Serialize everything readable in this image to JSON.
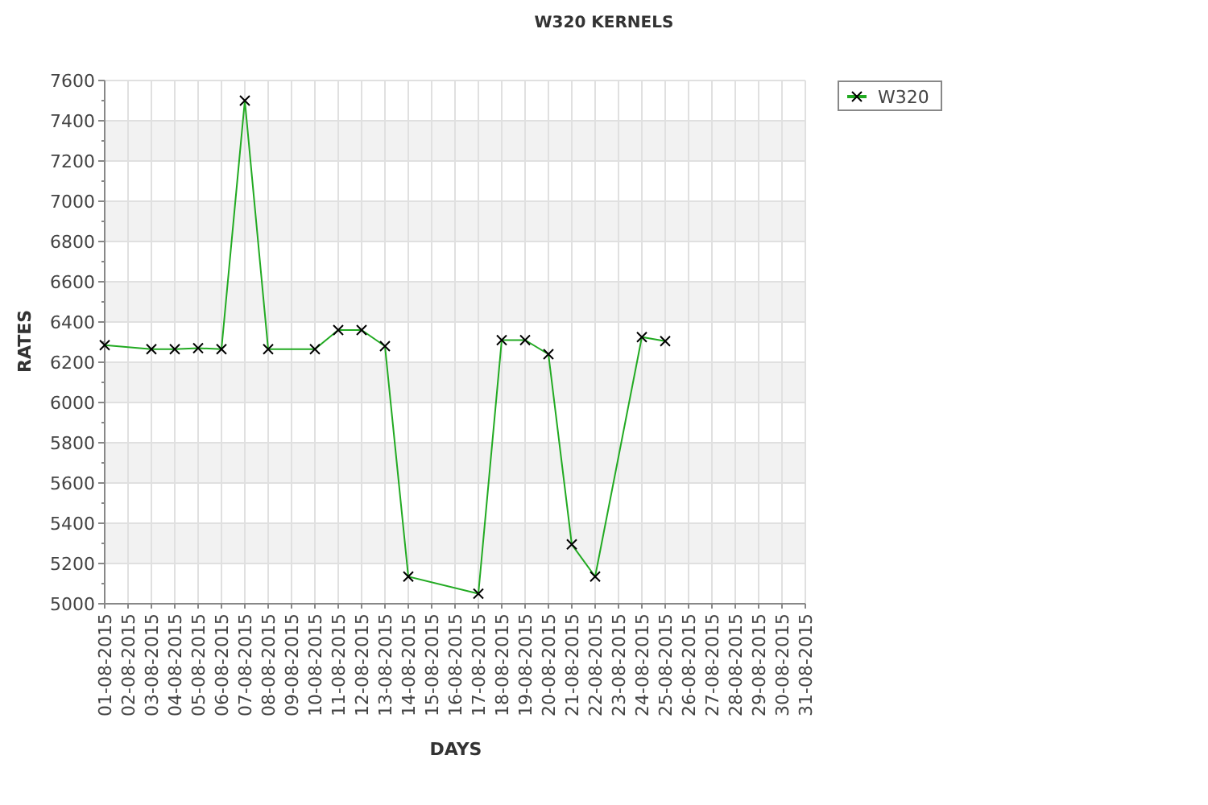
{
  "chart_data": {
    "type": "line",
    "title": "W320 KERNELS",
    "xlabel": "DAYS",
    "ylabel": "RATES",
    "categories": [
      "01-08-2015",
      "02-08-2015",
      "03-08-2015",
      "04-08-2015",
      "05-08-2015",
      "06-08-2015",
      "07-08-2015",
      "08-08-2015",
      "09-08-2015",
      "10-08-2015",
      "11-08-2015",
      "12-08-2015",
      "13-08-2015",
      "14-08-2015",
      "15-08-2015",
      "16-08-2015",
      "17-08-2015",
      "18-08-2015",
      "19-08-2015",
      "20-08-2015",
      "21-08-2015",
      "22-08-2015",
      "23-08-2015",
      "24-08-2015",
      "25-08-2015",
      "26-08-2015",
      "27-08-2015",
      "28-08-2015",
      "29-08-2015",
      "30-08-2015",
      "31-08-2015"
    ],
    "grid": true,
    "series": [
      {
        "name": "W320",
        "color": "#22aa22",
        "marker": "x",
        "values": [
          6285,
          null,
          6265,
          6265,
          6270,
          6265,
          7500,
          6265,
          null,
          6265,
          6360,
          6360,
          6280,
          5135,
          null,
          null,
          5050,
          6310,
          6310,
          6240,
          5295,
          5135,
          null,
          6325,
          6305,
          null,
          null,
          null,
          null,
          null,
          null
        ]
      }
    ],
    "ylim": [
      5000,
      7600
    ],
    "yticks": [
      5000,
      5200,
      5400,
      5600,
      5800,
      6000,
      6200,
      6400,
      6600,
      6800,
      7000,
      7200,
      7400,
      7600
    ]
  }
}
